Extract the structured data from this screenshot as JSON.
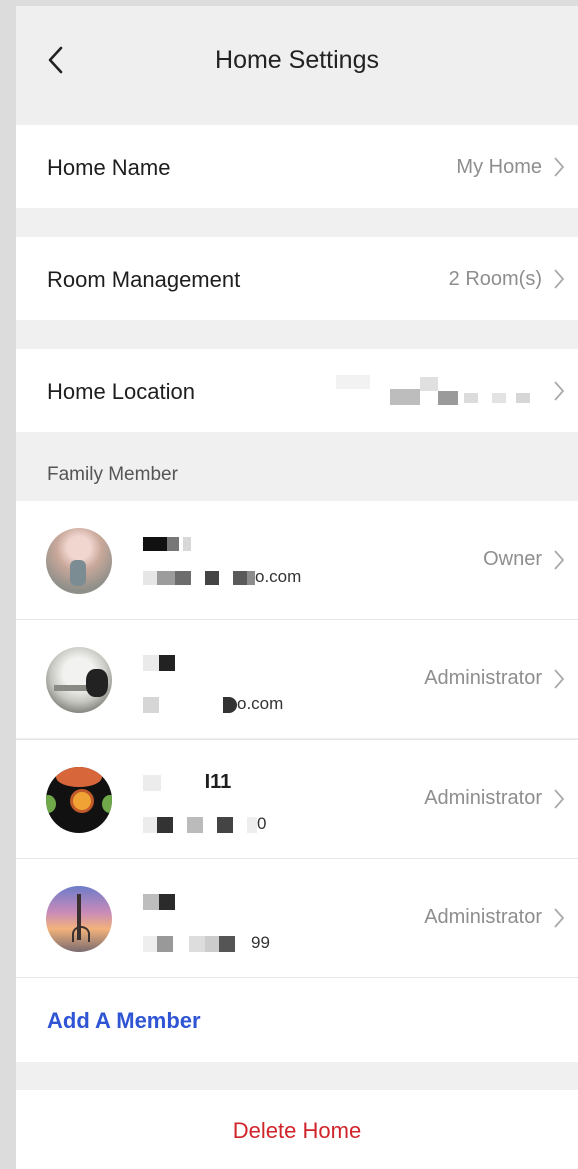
{
  "header": {
    "title": "Home Settings",
    "back_icon": "chevron-left-icon"
  },
  "settings": [
    {
      "label": "Home Name",
      "value": "My Home"
    },
    {
      "label": "Room Management",
      "value": "2 Room(s)"
    },
    {
      "label": "Home Location",
      "value": ""
    }
  ],
  "family": {
    "section_label": "Family Member",
    "members": [
      {
        "name": "",
        "email": "o.com",
        "role": "Owner"
      },
      {
        "name": "",
        "email": "o.com",
        "role": "Administrator"
      },
      {
        "name": "I11",
        "email": "0",
        "role": "Administrator"
      },
      {
        "name": "",
        "email": "99",
        "role": "Administrator"
      }
    ],
    "add_label": "Add A Member"
  },
  "delete_label": "Delete Home",
  "colors": {
    "accent": "#2f55d4",
    "danger": "#d0242b",
    "value_gray": "#8e8e8e"
  }
}
